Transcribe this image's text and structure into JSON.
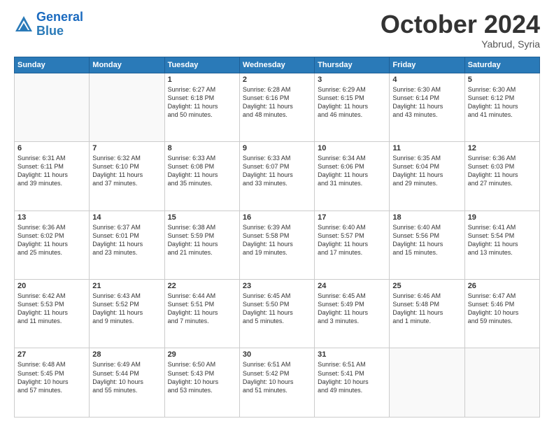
{
  "header": {
    "logo_line1": "General",
    "logo_line2": "Blue",
    "month": "October 2024",
    "location": "Yabrud, Syria"
  },
  "days_of_week": [
    "Sunday",
    "Monday",
    "Tuesday",
    "Wednesday",
    "Thursday",
    "Friday",
    "Saturday"
  ],
  "weeks": [
    [
      {
        "day": "",
        "lines": []
      },
      {
        "day": "",
        "lines": []
      },
      {
        "day": "1",
        "lines": [
          "Sunrise: 6:27 AM",
          "Sunset: 6:18 PM",
          "Daylight: 11 hours",
          "and 50 minutes."
        ]
      },
      {
        "day": "2",
        "lines": [
          "Sunrise: 6:28 AM",
          "Sunset: 6:16 PM",
          "Daylight: 11 hours",
          "and 48 minutes."
        ]
      },
      {
        "day": "3",
        "lines": [
          "Sunrise: 6:29 AM",
          "Sunset: 6:15 PM",
          "Daylight: 11 hours",
          "and 46 minutes."
        ]
      },
      {
        "day": "4",
        "lines": [
          "Sunrise: 6:30 AM",
          "Sunset: 6:14 PM",
          "Daylight: 11 hours",
          "and 43 minutes."
        ]
      },
      {
        "day": "5",
        "lines": [
          "Sunrise: 6:30 AM",
          "Sunset: 6:12 PM",
          "Daylight: 11 hours",
          "and 41 minutes."
        ]
      }
    ],
    [
      {
        "day": "6",
        "lines": [
          "Sunrise: 6:31 AM",
          "Sunset: 6:11 PM",
          "Daylight: 11 hours",
          "and 39 minutes."
        ]
      },
      {
        "day": "7",
        "lines": [
          "Sunrise: 6:32 AM",
          "Sunset: 6:10 PM",
          "Daylight: 11 hours",
          "and 37 minutes."
        ]
      },
      {
        "day": "8",
        "lines": [
          "Sunrise: 6:33 AM",
          "Sunset: 6:08 PM",
          "Daylight: 11 hours",
          "and 35 minutes."
        ]
      },
      {
        "day": "9",
        "lines": [
          "Sunrise: 6:33 AM",
          "Sunset: 6:07 PM",
          "Daylight: 11 hours",
          "and 33 minutes."
        ]
      },
      {
        "day": "10",
        "lines": [
          "Sunrise: 6:34 AM",
          "Sunset: 6:06 PM",
          "Daylight: 11 hours",
          "and 31 minutes."
        ]
      },
      {
        "day": "11",
        "lines": [
          "Sunrise: 6:35 AM",
          "Sunset: 6:04 PM",
          "Daylight: 11 hours",
          "and 29 minutes."
        ]
      },
      {
        "day": "12",
        "lines": [
          "Sunrise: 6:36 AM",
          "Sunset: 6:03 PM",
          "Daylight: 11 hours",
          "and 27 minutes."
        ]
      }
    ],
    [
      {
        "day": "13",
        "lines": [
          "Sunrise: 6:36 AM",
          "Sunset: 6:02 PM",
          "Daylight: 11 hours",
          "and 25 minutes."
        ]
      },
      {
        "day": "14",
        "lines": [
          "Sunrise: 6:37 AM",
          "Sunset: 6:01 PM",
          "Daylight: 11 hours",
          "and 23 minutes."
        ]
      },
      {
        "day": "15",
        "lines": [
          "Sunrise: 6:38 AM",
          "Sunset: 5:59 PM",
          "Daylight: 11 hours",
          "and 21 minutes."
        ]
      },
      {
        "day": "16",
        "lines": [
          "Sunrise: 6:39 AM",
          "Sunset: 5:58 PM",
          "Daylight: 11 hours",
          "and 19 minutes."
        ]
      },
      {
        "day": "17",
        "lines": [
          "Sunrise: 6:40 AM",
          "Sunset: 5:57 PM",
          "Daylight: 11 hours",
          "and 17 minutes."
        ]
      },
      {
        "day": "18",
        "lines": [
          "Sunrise: 6:40 AM",
          "Sunset: 5:56 PM",
          "Daylight: 11 hours",
          "and 15 minutes."
        ]
      },
      {
        "day": "19",
        "lines": [
          "Sunrise: 6:41 AM",
          "Sunset: 5:54 PM",
          "Daylight: 11 hours",
          "and 13 minutes."
        ]
      }
    ],
    [
      {
        "day": "20",
        "lines": [
          "Sunrise: 6:42 AM",
          "Sunset: 5:53 PM",
          "Daylight: 11 hours",
          "and 11 minutes."
        ]
      },
      {
        "day": "21",
        "lines": [
          "Sunrise: 6:43 AM",
          "Sunset: 5:52 PM",
          "Daylight: 11 hours",
          "and 9 minutes."
        ]
      },
      {
        "day": "22",
        "lines": [
          "Sunrise: 6:44 AM",
          "Sunset: 5:51 PM",
          "Daylight: 11 hours",
          "and 7 minutes."
        ]
      },
      {
        "day": "23",
        "lines": [
          "Sunrise: 6:45 AM",
          "Sunset: 5:50 PM",
          "Daylight: 11 hours",
          "and 5 minutes."
        ]
      },
      {
        "day": "24",
        "lines": [
          "Sunrise: 6:45 AM",
          "Sunset: 5:49 PM",
          "Daylight: 11 hours",
          "and 3 minutes."
        ]
      },
      {
        "day": "25",
        "lines": [
          "Sunrise: 6:46 AM",
          "Sunset: 5:48 PM",
          "Daylight: 11 hours",
          "and 1 minute."
        ]
      },
      {
        "day": "26",
        "lines": [
          "Sunrise: 6:47 AM",
          "Sunset: 5:46 PM",
          "Daylight: 10 hours",
          "and 59 minutes."
        ]
      }
    ],
    [
      {
        "day": "27",
        "lines": [
          "Sunrise: 6:48 AM",
          "Sunset: 5:45 PM",
          "Daylight: 10 hours",
          "and 57 minutes."
        ]
      },
      {
        "day": "28",
        "lines": [
          "Sunrise: 6:49 AM",
          "Sunset: 5:44 PM",
          "Daylight: 10 hours",
          "and 55 minutes."
        ]
      },
      {
        "day": "29",
        "lines": [
          "Sunrise: 6:50 AM",
          "Sunset: 5:43 PM",
          "Daylight: 10 hours",
          "and 53 minutes."
        ]
      },
      {
        "day": "30",
        "lines": [
          "Sunrise: 6:51 AM",
          "Sunset: 5:42 PM",
          "Daylight: 10 hours",
          "and 51 minutes."
        ]
      },
      {
        "day": "31",
        "lines": [
          "Sunrise: 6:51 AM",
          "Sunset: 5:41 PM",
          "Daylight: 10 hours",
          "and 49 minutes."
        ]
      },
      {
        "day": "",
        "lines": []
      },
      {
        "day": "",
        "lines": []
      }
    ]
  ]
}
